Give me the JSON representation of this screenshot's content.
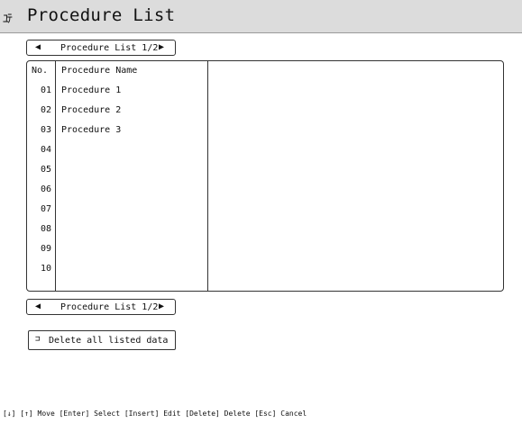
{
  "title_bar": {
    "icon_glyph": "ﾕﾃ",
    "icon": "procedure-icon",
    "title": "Procedure List"
  },
  "pager_top": {
    "left_arrow": "◀",
    "label": "Procedure List  1/2",
    "right_arrow": "▶"
  },
  "table": {
    "headers": {
      "no": "No.",
      "name": "Procedure Name"
    },
    "rows": [
      {
        "no": "01",
        "name": "Procedure 1"
      },
      {
        "no": "02",
        "name": "Procedure 2"
      },
      {
        "no": "03",
        "name": "Procedure 3"
      },
      {
        "no": "04",
        "name": ""
      },
      {
        "no": "05",
        "name": ""
      },
      {
        "no": "06",
        "name": ""
      },
      {
        "no": "07",
        "name": ""
      },
      {
        "no": "08",
        "name": ""
      },
      {
        "no": "09",
        "name": ""
      },
      {
        "no": "10",
        "name": ""
      }
    ]
  },
  "pager_bottom": {
    "left_arrow": "◀",
    "label": "Procedure List  1/2",
    "right_arrow": "▶"
  },
  "delete_button": {
    "icon_glyph": "⊐",
    "icon": "delete-list-icon",
    "label": "Delete all listed data"
  },
  "help_text": "[↓] [↑] Move  [Enter] Select  [Insert] Edit  [Delete] Delete  [Esc] Cancel"
}
